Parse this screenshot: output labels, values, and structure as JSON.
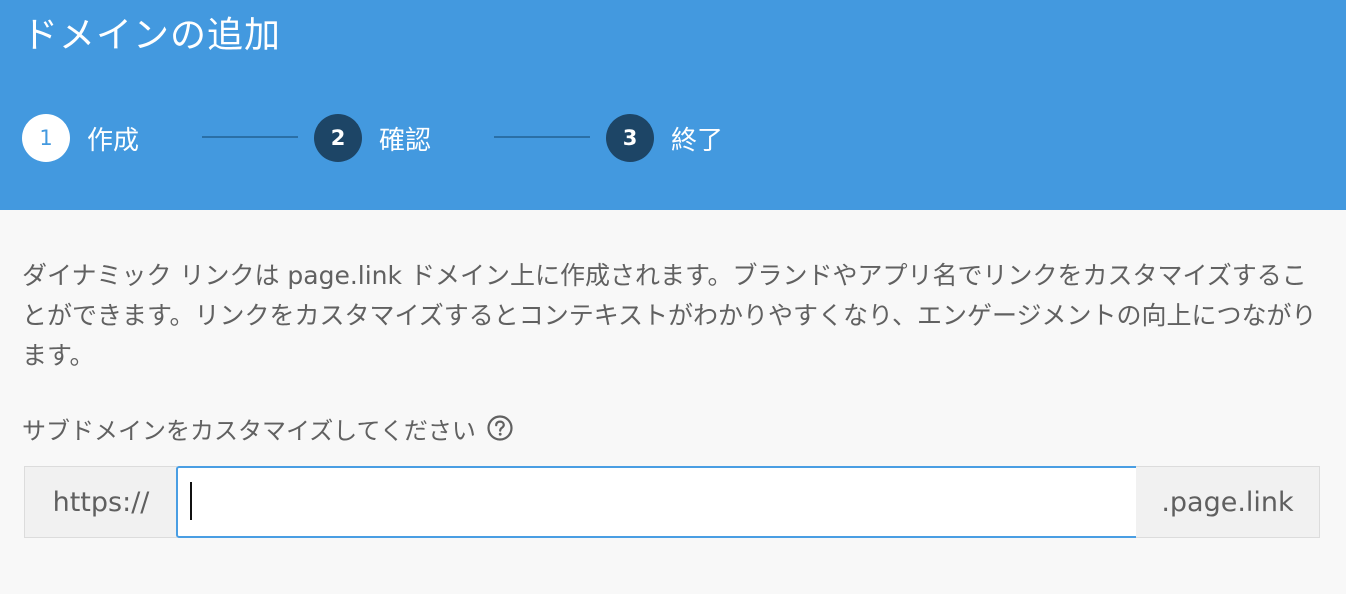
{
  "header": {
    "title": "ドメインの追加",
    "background_color": "#4399df",
    "steps": [
      {
        "number": "1",
        "label": "作成",
        "state": "active"
      },
      {
        "number": "2",
        "label": "確認",
        "state": "inactive"
      },
      {
        "number": "3",
        "label": "終了",
        "state": "inactive"
      }
    ]
  },
  "main": {
    "description": "ダイナミック リンクは page.link ドメイン上に作成されます。ブランドやアプリ名でリンクをカスタマイズすることができます。リンクをカスタマイズするとコンテキストがわかりやすくなり、エンゲージメントの向上につながります。",
    "subdomain_label": "サブドメインをカスタマイズしてください",
    "help_icon": "help-circle-icon",
    "input": {
      "prefix": "https://",
      "value": "",
      "placeholder": "",
      "suffix": ".page.link"
    }
  },
  "colors": {
    "accent": "#4399df",
    "step_inactive": "#1d4566",
    "input_focus_border": "#4a9ee3"
  }
}
